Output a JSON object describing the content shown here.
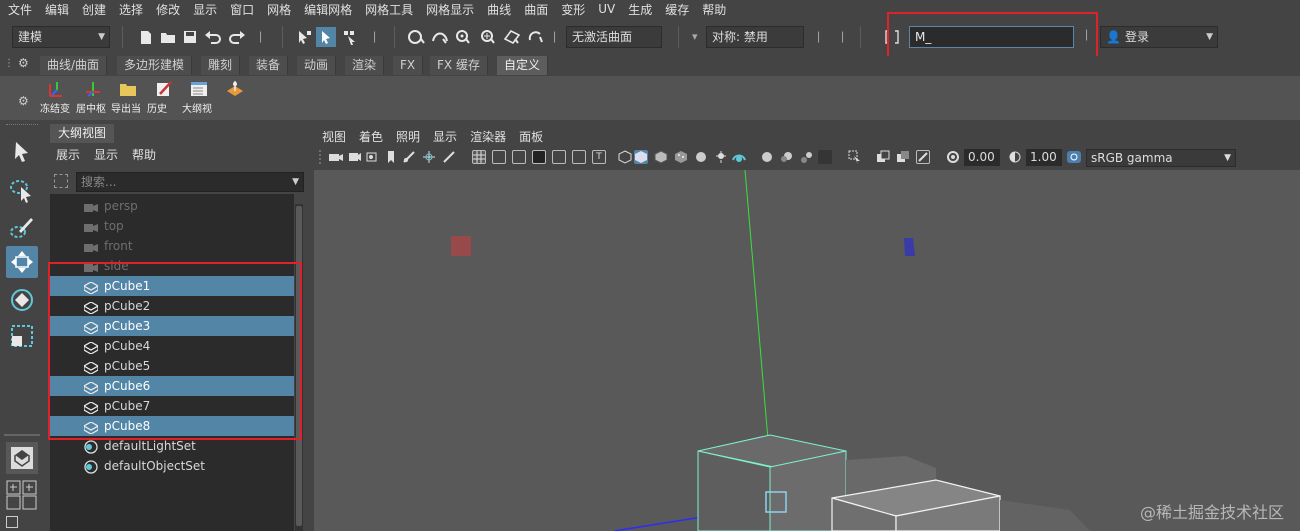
{
  "menubar": [
    "文件",
    "编辑",
    "创建",
    "选择",
    "修改",
    "显示",
    "窗口",
    "网格",
    "编辑网格",
    "网格工具",
    "网格显示",
    "曲线",
    "曲面",
    "变形",
    "UV",
    "生成",
    "缓存",
    "帮助"
  ],
  "statusline": {
    "mode": "建模",
    "live_surface": "无激活曲面",
    "symmetry": "对称: 禁用",
    "command_input": "M_",
    "login": "登录"
  },
  "shelf_tabs": [
    "曲线/曲面",
    "多边形建模",
    "雕刻",
    "装备",
    "动画",
    "渲染",
    "FX",
    "FX 缓存",
    "自定义"
  ],
  "shelf_active_tab": "自定义",
  "shelf_buttons": [
    "冻结变",
    "居中枢",
    "导出当",
    "历史",
    "大纲视"
  ],
  "outliner": {
    "tab": "大纲视图",
    "menu": [
      "展示",
      "显示",
      "帮助"
    ],
    "search_placeholder": "搜索...",
    "items": [
      {
        "name": "persp",
        "kind": "camera",
        "selected": false
      },
      {
        "name": "top",
        "kind": "camera",
        "selected": false
      },
      {
        "name": "front",
        "kind": "camera",
        "selected": false
      },
      {
        "name": "side",
        "kind": "camera",
        "selected": false
      },
      {
        "name": "pCube1",
        "kind": "mesh",
        "selected": true
      },
      {
        "name": "pCube2",
        "kind": "mesh",
        "selected": false
      },
      {
        "name": "pCube3",
        "kind": "mesh",
        "selected": true
      },
      {
        "name": "pCube4",
        "kind": "mesh",
        "selected": false
      },
      {
        "name": "pCube5",
        "kind": "mesh",
        "selected": false
      },
      {
        "name": "pCube6",
        "kind": "mesh",
        "selected": true
      },
      {
        "name": "pCube7",
        "kind": "mesh",
        "selected": false
      },
      {
        "name": "pCube8",
        "kind": "mesh",
        "selected": true
      },
      {
        "name": "defaultLightSet",
        "kind": "set",
        "selected": false
      },
      {
        "name": "defaultObjectSet",
        "kind": "set",
        "selected": false
      }
    ]
  },
  "viewport": {
    "menu": [
      "视图",
      "着色",
      "照明",
      "显示",
      "渲染器",
      "面板"
    ],
    "exposure": "0.00",
    "gamma": "1.00",
    "color_space": "sRGB gamma"
  },
  "watermark": "@稀土掘金技术社区",
  "colors": {
    "selection": "#5285a6",
    "highlight_box": "#e0202a",
    "viewport_bg": "#595959"
  }
}
